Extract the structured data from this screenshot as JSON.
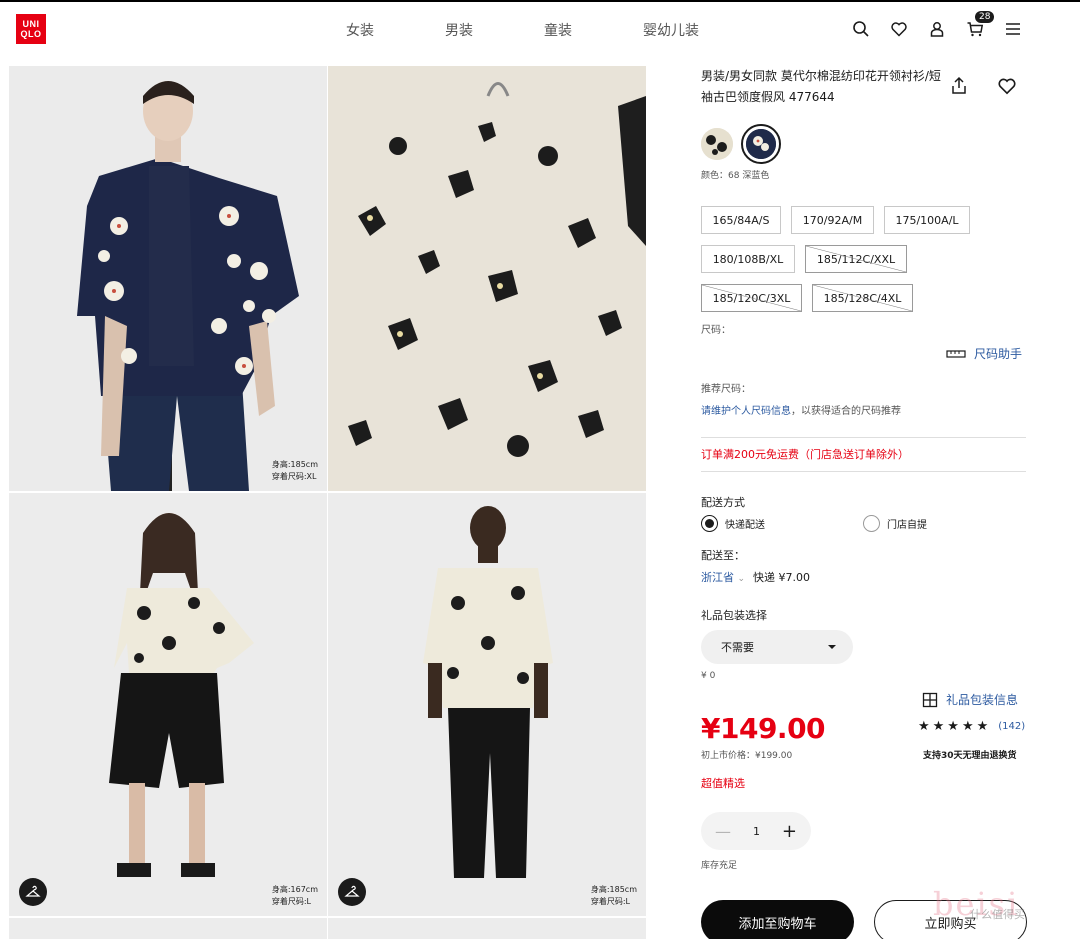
{
  "header": {
    "logo_lines": [
      "UNI",
      "QLO"
    ],
    "nav": [
      "女装",
      "男装",
      "童装",
      "婴幼儿装"
    ],
    "cart_count": "28"
  },
  "gallery": {
    "captions": [
      {
        "height": "身高:185cm",
        "size": "穿着尺码:XL"
      },
      {
        "height": "身高:167cm",
        "size": "穿着尺码:L"
      },
      {
        "height": "身高:185cm",
        "size": "穿着尺码:L"
      }
    ]
  },
  "product": {
    "title": "男装/男女同款 莫代尔棉混纺印花开领衬衫/短袖古巴领度假风 477644",
    "color_label": "颜色：68 深蓝色",
    "sizes": [
      {
        "label": "165/84A/S",
        "available": true
      },
      {
        "label": "170/92A/M",
        "available": true
      },
      {
        "label": "175/100A/L",
        "available": true
      },
      {
        "label": "180/108B/XL",
        "available": true
      },
      {
        "label": "185/112C/XXL",
        "available": false
      },
      {
        "label": "185/120C/3XL",
        "available": false
      },
      {
        "label": "185/128C/4XL",
        "available": false
      }
    ],
    "size_label": "尺码：",
    "size_help": "尺码助手",
    "rec_label": "推荐尺码：",
    "rec_link": "请维护个人尺码信息",
    "rec_rest": "，以获得适合的尺码推荐",
    "ship_msg": "订单满200元免运费（门店急送订单除外）",
    "delivery_label": "配送方式",
    "delivery_options": [
      "快递配送",
      "门店自提"
    ],
    "ship_to_label": "配送至：",
    "province": "浙江省",
    "express": "快递 ¥7.00",
    "gift_label": "礼品包装选择",
    "gift_selected": "不需要",
    "gift_price": "¥ 0",
    "gift_info": "礼品包装信息",
    "price": "¥149.00",
    "stars": "★★★★★",
    "review_count": "(142)",
    "orig_price": "初上市价格：¥199.00",
    "returns": "支持30天无理由退换货",
    "value_tag": "超值精选",
    "qty_minus": "—",
    "quantity": "1",
    "qty_plus": "+",
    "stock": "库存充足",
    "add_to_cart": "添加至购物车",
    "buy_now": "立即购买"
  },
  "watermark": {
    "text": "beisi",
    "sub": "什么值得买"
  },
  "colors": {
    "brand_red": "#e60012",
    "link_blue": "#2c5aa0",
    "dark": "#1b1b1b",
    "navy_shirt": "#1f2a4a"
  }
}
